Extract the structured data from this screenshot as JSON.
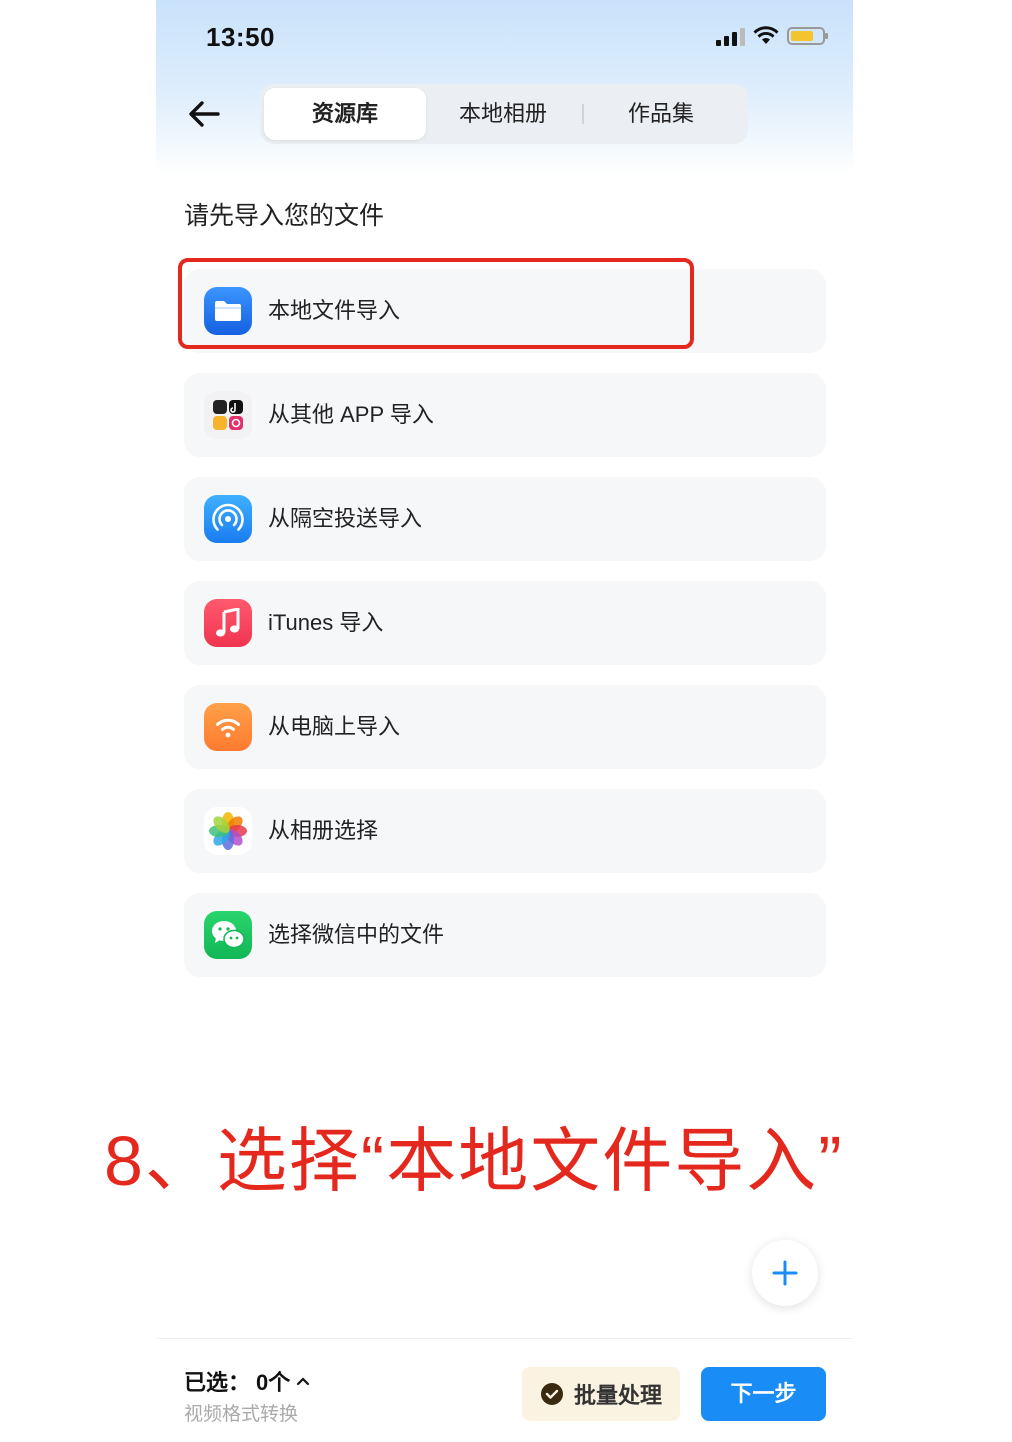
{
  "status": {
    "time": "13:50"
  },
  "tabs": [
    {
      "label": "资源库",
      "active": true
    },
    {
      "label": "本地相册",
      "active": false
    },
    {
      "label": "作品集",
      "active": false
    }
  ],
  "heading": "请先导入您的文件",
  "items": [
    {
      "label": "本地文件导入",
      "icon": "folder-icon",
      "color": "#1f7cf0"
    },
    {
      "label": "从其他 APP 导入",
      "icon": "other-apps-icon",
      "color": "#f0f0f0"
    },
    {
      "label": "从隔空投送导入",
      "icon": "airdrop-icon",
      "color": "#1b9af5"
    },
    {
      "label": "iTunes 导入",
      "icon": "music-note-icon",
      "color": "#f4405a"
    },
    {
      "label": "从电脑上导入",
      "icon": "wifi-icon",
      "color": "#ff8c3a"
    },
    {
      "label": "从相册选择",
      "icon": "photos-flower-icon",
      "color": "#ffffff"
    },
    {
      "label": "选择微信中的文件",
      "icon": "wechat-icon",
      "color": "#1fc160"
    }
  ],
  "caption": "8、选择“本地文件导入”",
  "bottom": {
    "selected_label": "已选：",
    "selected_count": "0个",
    "subtext": "视频格式转换",
    "batch_label": "批量处理",
    "next_label": "下一步"
  },
  "colors": {
    "accent": "#1a8cf5",
    "highlight": "#e5281e"
  }
}
